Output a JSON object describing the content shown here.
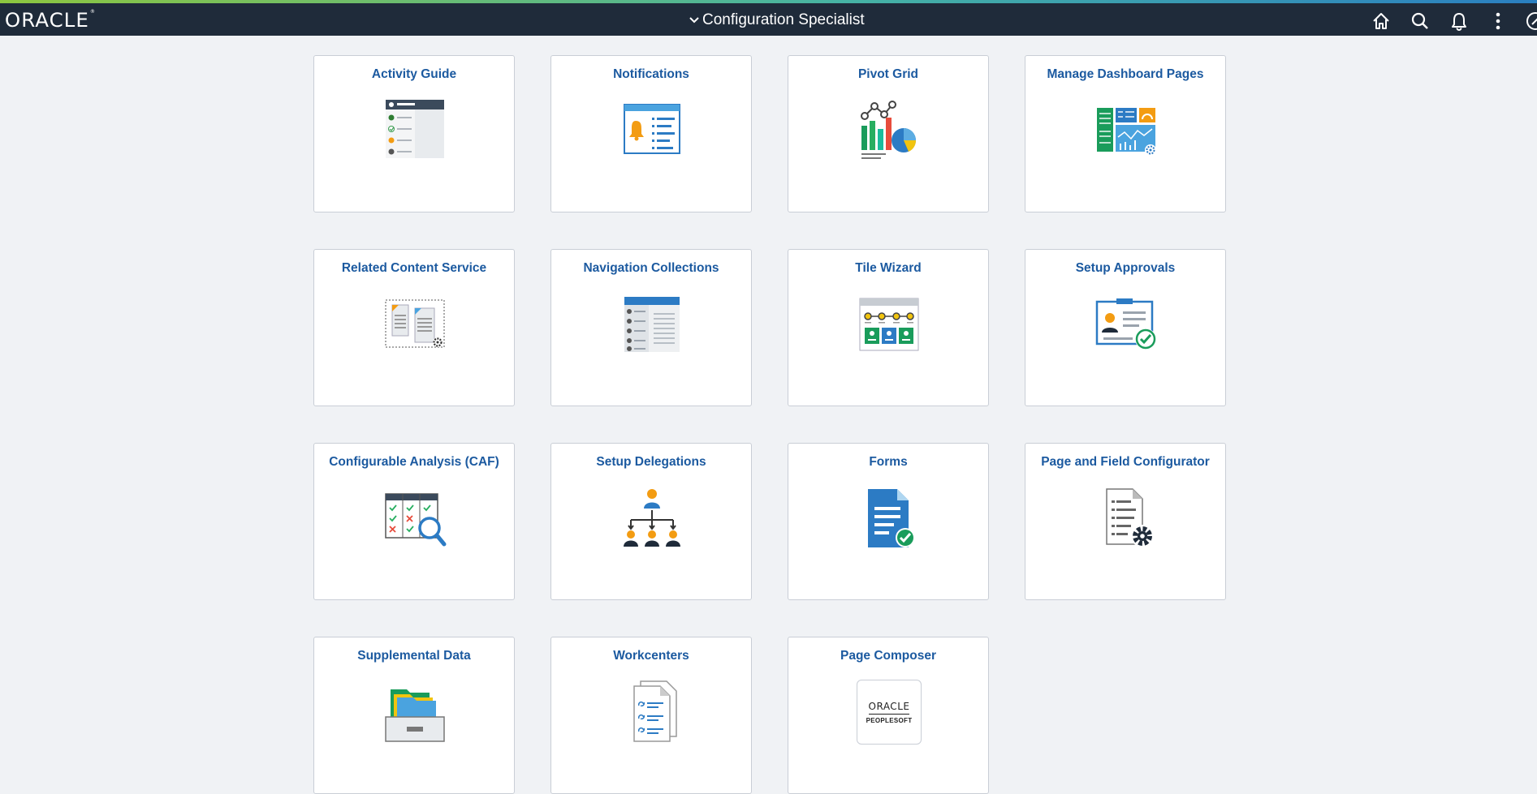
{
  "header": {
    "logo": "ORACLE",
    "title": "Configuration Specialist",
    "icons": [
      "home-icon",
      "search-icon",
      "notification-bell-icon",
      "more-actions-icon",
      "navbar-icon"
    ]
  },
  "colors": {
    "header_bg": "#1f2b3a",
    "page_bg": "#f0f2f5",
    "tile_label": "#1c5aa0",
    "accent_green": "#1a9c5b",
    "accent_blue": "#2c7bc4",
    "accent_orange": "#f39c12"
  },
  "tiles": [
    {
      "label": "Activity Guide",
      "icon": "activity-guide-icon"
    },
    {
      "label": "Notifications",
      "icon": "notifications-icon"
    },
    {
      "label": "Pivot Grid",
      "icon": "pivot-grid-icon"
    },
    {
      "label": "Manage Dashboard Pages",
      "icon": "dashboard-pages-icon"
    },
    {
      "label": "Related Content Service",
      "icon": "related-content-icon"
    },
    {
      "label": "Navigation Collections",
      "icon": "navigation-collections-icon"
    },
    {
      "label": "Tile Wizard",
      "icon": "tile-wizard-icon"
    },
    {
      "label": "Setup Approvals",
      "icon": "setup-approvals-icon"
    },
    {
      "label": "Configurable Analysis (CAF)",
      "icon": "configurable-analysis-icon"
    },
    {
      "label": "Setup Delegations",
      "icon": "setup-delegations-icon"
    },
    {
      "label": "Forms",
      "icon": "forms-icon"
    },
    {
      "label": "Page and Field Configurator",
      "icon": "page-field-configurator-icon"
    },
    {
      "label": "Supplemental Data",
      "icon": "supplemental-data-icon"
    },
    {
      "label": "Workcenters",
      "icon": "workcenters-icon"
    },
    {
      "label": "Page Composer",
      "icon": "page-composer-icon",
      "logo_text": "ORACLE",
      "logo_sub": "PEOPLESOFT"
    }
  ]
}
